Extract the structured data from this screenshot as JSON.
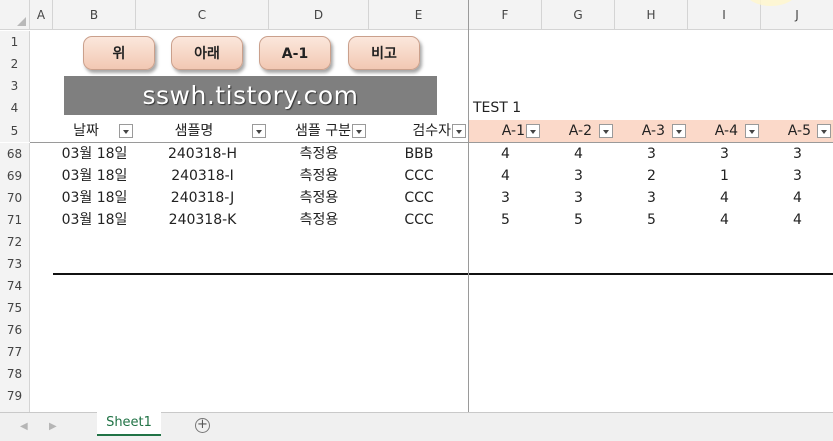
{
  "columns": [
    "A",
    "B",
    "C",
    "D",
    "E",
    "F",
    "G",
    "H",
    "I",
    "J"
  ],
  "rows": [
    "1",
    "2",
    "3",
    "4",
    "5",
    "68",
    "69",
    "70",
    "71",
    "72",
    "73",
    "74",
    "75",
    "76",
    "77",
    "78",
    "79"
  ],
  "buttons": [
    "위",
    "아래",
    "A-1",
    "비고"
  ],
  "banner": "sswh.tistory.com",
  "test_label": "TEST 1",
  "headers": {
    "date": "날짜",
    "sample": "샘플명",
    "sample_type": "샘플 구분",
    "inspector": "검수자",
    "a": [
      "A-1",
      "A-2",
      "A-3",
      "A-4",
      "A-5"
    ]
  },
  "data_rows": [
    {
      "date": "03월 18일",
      "sample": "240318-H",
      "type": "측정용",
      "inspector": "BBB",
      "vals": [
        "4",
        "4",
        "3",
        "3",
        "3"
      ]
    },
    {
      "date": "03월 18일",
      "sample": "240318-I",
      "type": "측정용",
      "inspector": "CCC",
      "vals": [
        "4",
        "3",
        "2",
        "1",
        "3"
      ]
    },
    {
      "date": "03월 18일",
      "sample": "240318-J",
      "type": "측정용",
      "inspector": "CCC",
      "vals": [
        "3",
        "3",
        "3",
        "4",
        "4"
      ]
    },
    {
      "date": "03월 18일",
      "sample": "240318-K",
      "type": "측정용",
      "inspector": "CCC",
      "vals": [
        "5",
        "5",
        "5",
        "4",
        "4"
      ]
    }
  ],
  "sheet_tab": "Sheet1",
  "add_sheet": "+",
  "colors": {
    "accent": "#217346",
    "header_fill": "#fbd9c9",
    "banner": "#7f7f7f"
  }
}
